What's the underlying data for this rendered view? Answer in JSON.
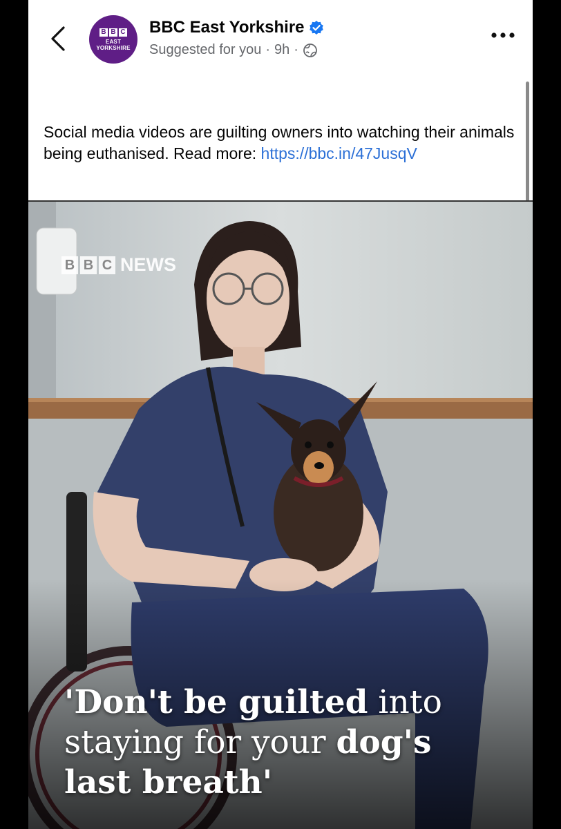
{
  "header": {
    "avatar_blocks": [
      "B",
      "B",
      "C"
    ],
    "avatar_line1": "EAST",
    "avatar_line2": "YORKSHIRE",
    "page_name": "BBC East Yorkshire",
    "suggested": "Suggested for you",
    "separator": "·",
    "time": "9h",
    "verified_color": "#1877f2"
  },
  "post": {
    "caption_text": "Social media videos are guilting owners into watching their animals being euthanised. Read more: ",
    "link_text": "https://bbc.in/47JusqV"
  },
  "media": {
    "bbc_blocks": [
      "B",
      "B",
      "C"
    ],
    "news_label": "NEWS",
    "headline": {
      "bold1": "'Don't be guilted",
      "normal1": " into staying for your ",
      "bold2": "dog's",
      "newline": "last breath'"
    }
  },
  "icons": [
    "back-chevron-icon",
    "verified-badge-icon",
    "globe-icon",
    "more-options-icon"
  ]
}
